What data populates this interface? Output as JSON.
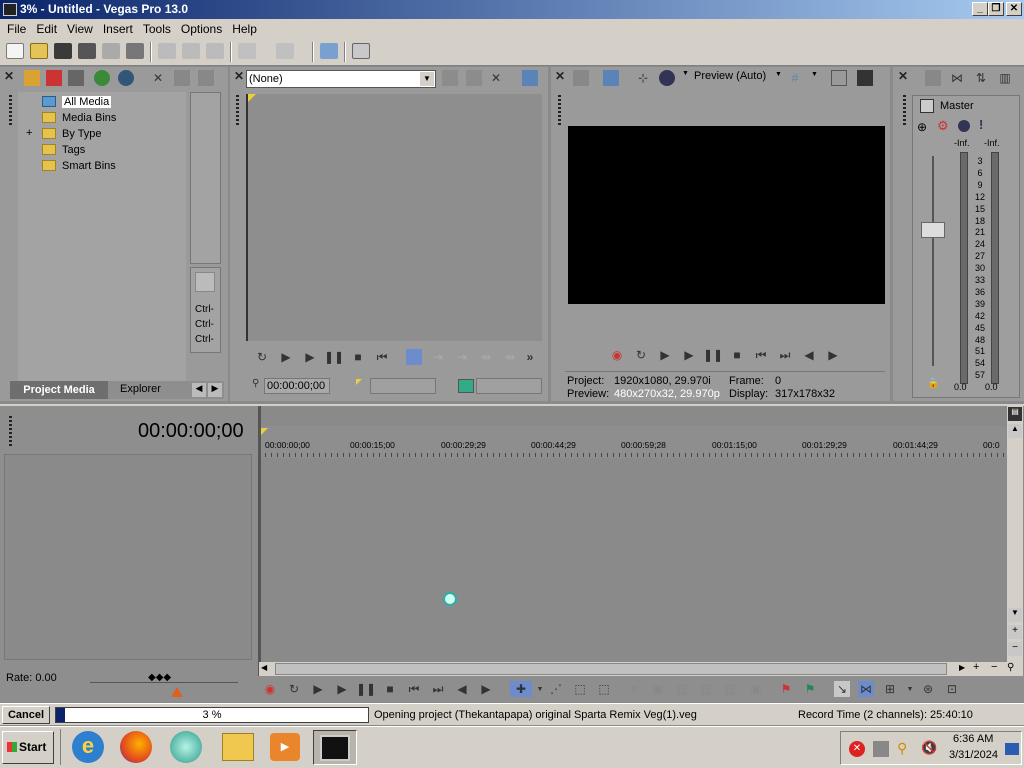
{
  "window": {
    "title": "3% - Untitled - Vegas Pro 13.0"
  },
  "menu": [
    "File",
    "Edit",
    "View",
    "Insert",
    "Tools",
    "Options",
    "Help"
  ],
  "project_media": {
    "tree": [
      "All Media",
      "Media Bins",
      "By Type",
      "Tags",
      "Smart Bins"
    ],
    "ctrl_labels": [
      "Ctrl-",
      "Ctrl-",
      "Ctrl-"
    ],
    "tabs": [
      "Project Media",
      "Explorer"
    ]
  },
  "trimmer": {
    "dropdown": "(None)",
    "timecode": "00:00:00;00"
  },
  "preview": {
    "mode": "Preview (Auto)",
    "project_label": "Project:",
    "project_value": "1920x1080, 29.970i",
    "preview_label": "Preview:",
    "preview_value": "480x270x32, 29.970p",
    "frame_label": "Frame:",
    "frame_value": "0",
    "display_label": "Display:",
    "display_value": "317x178x32"
  },
  "master": {
    "title": "Master",
    "inf_left": "-Inf.",
    "inf_right": "-Inf.",
    "scale": [
      "3",
      "6",
      "9",
      "12",
      "15",
      "18",
      "21",
      "24",
      "27",
      "30",
      "33",
      "36",
      "39",
      "42",
      "45",
      "48",
      "51",
      "54",
      "57"
    ],
    "bottom_left": "0.0",
    "bottom_right": "0.0"
  },
  "timeline": {
    "timecode": "00:00:00;00",
    "ruler": [
      "00:00:00;00",
      "00:00:15;00",
      "00:00:29;29",
      "00:00:44;29",
      "00:00:59;28",
      "00:01:15;00",
      "00:01:29;29",
      "00:01:44;29",
      "00:0"
    ],
    "rate": "Rate: 0.00"
  },
  "status": {
    "cancel": "Cancel",
    "progress_text": "3 %",
    "progress": 0.03,
    "message": "Opening project (Thekantapapa) original Sparta Remix Veg(1).veg",
    "record_time": "Record Time (2 channels): 25:40:10"
  },
  "taskbar": {
    "start": "Start",
    "time": "6:36 AM",
    "date": "3/31/2024"
  }
}
